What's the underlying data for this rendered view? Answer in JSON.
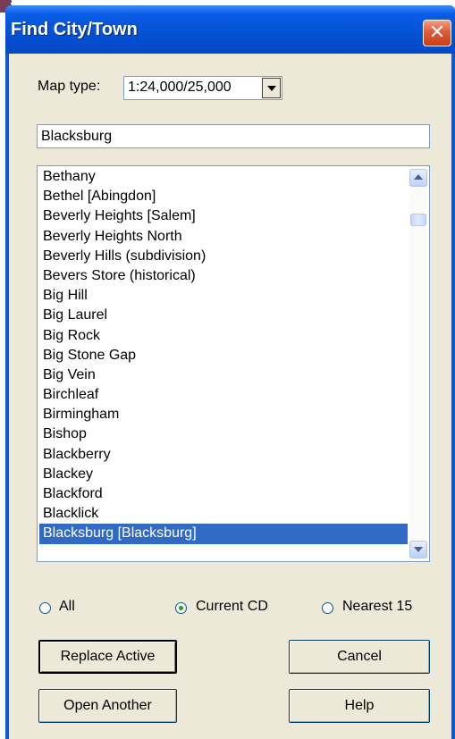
{
  "window": {
    "title": "Find City/Town",
    "close_symbol": "✕"
  },
  "map_type": {
    "label": "Map type:",
    "selected": "1:24,000/25,000"
  },
  "search": {
    "value": "Blacksburg"
  },
  "results": {
    "items": [
      "Bethany",
      "Bethel  [Abingdon]",
      "Beverly Heights  [Salem]",
      "Beverly Heights North",
      "Beverly Hills (subdivision)",
      "Bevers Store (historical)",
      "Big Hill",
      "Big Laurel",
      "Big Rock",
      "Big Stone Gap",
      "Big Vein",
      "Birchleaf",
      "Birmingham",
      "Bishop",
      "Blackberry",
      "Blackey",
      "Blackford",
      "Blacklick",
      "Blacksburg  [Blacksburg]"
    ],
    "selected": "Blacksburg  [Blacksburg]"
  },
  "scope": {
    "options": [
      "All",
      "Current CD",
      "Nearest 15"
    ],
    "selected": "Current CD"
  },
  "buttons": {
    "replace_active": "Replace Active",
    "cancel": "Cancel",
    "open_another": "Open Another",
    "help": "Help"
  },
  "icons": {
    "close": "close-icon",
    "dropdown": "chevron-down-icon",
    "scroll_up": "scroll-up-icon",
    "scroll_down": "scroll-down-icon"
  },
  "colors": {
    "titlebar": "#0452d6",
    "selection": "#316ac5",
    "dialog_bg": "#ece9d8",
    "close_button": "#e25a32"
  }
}
